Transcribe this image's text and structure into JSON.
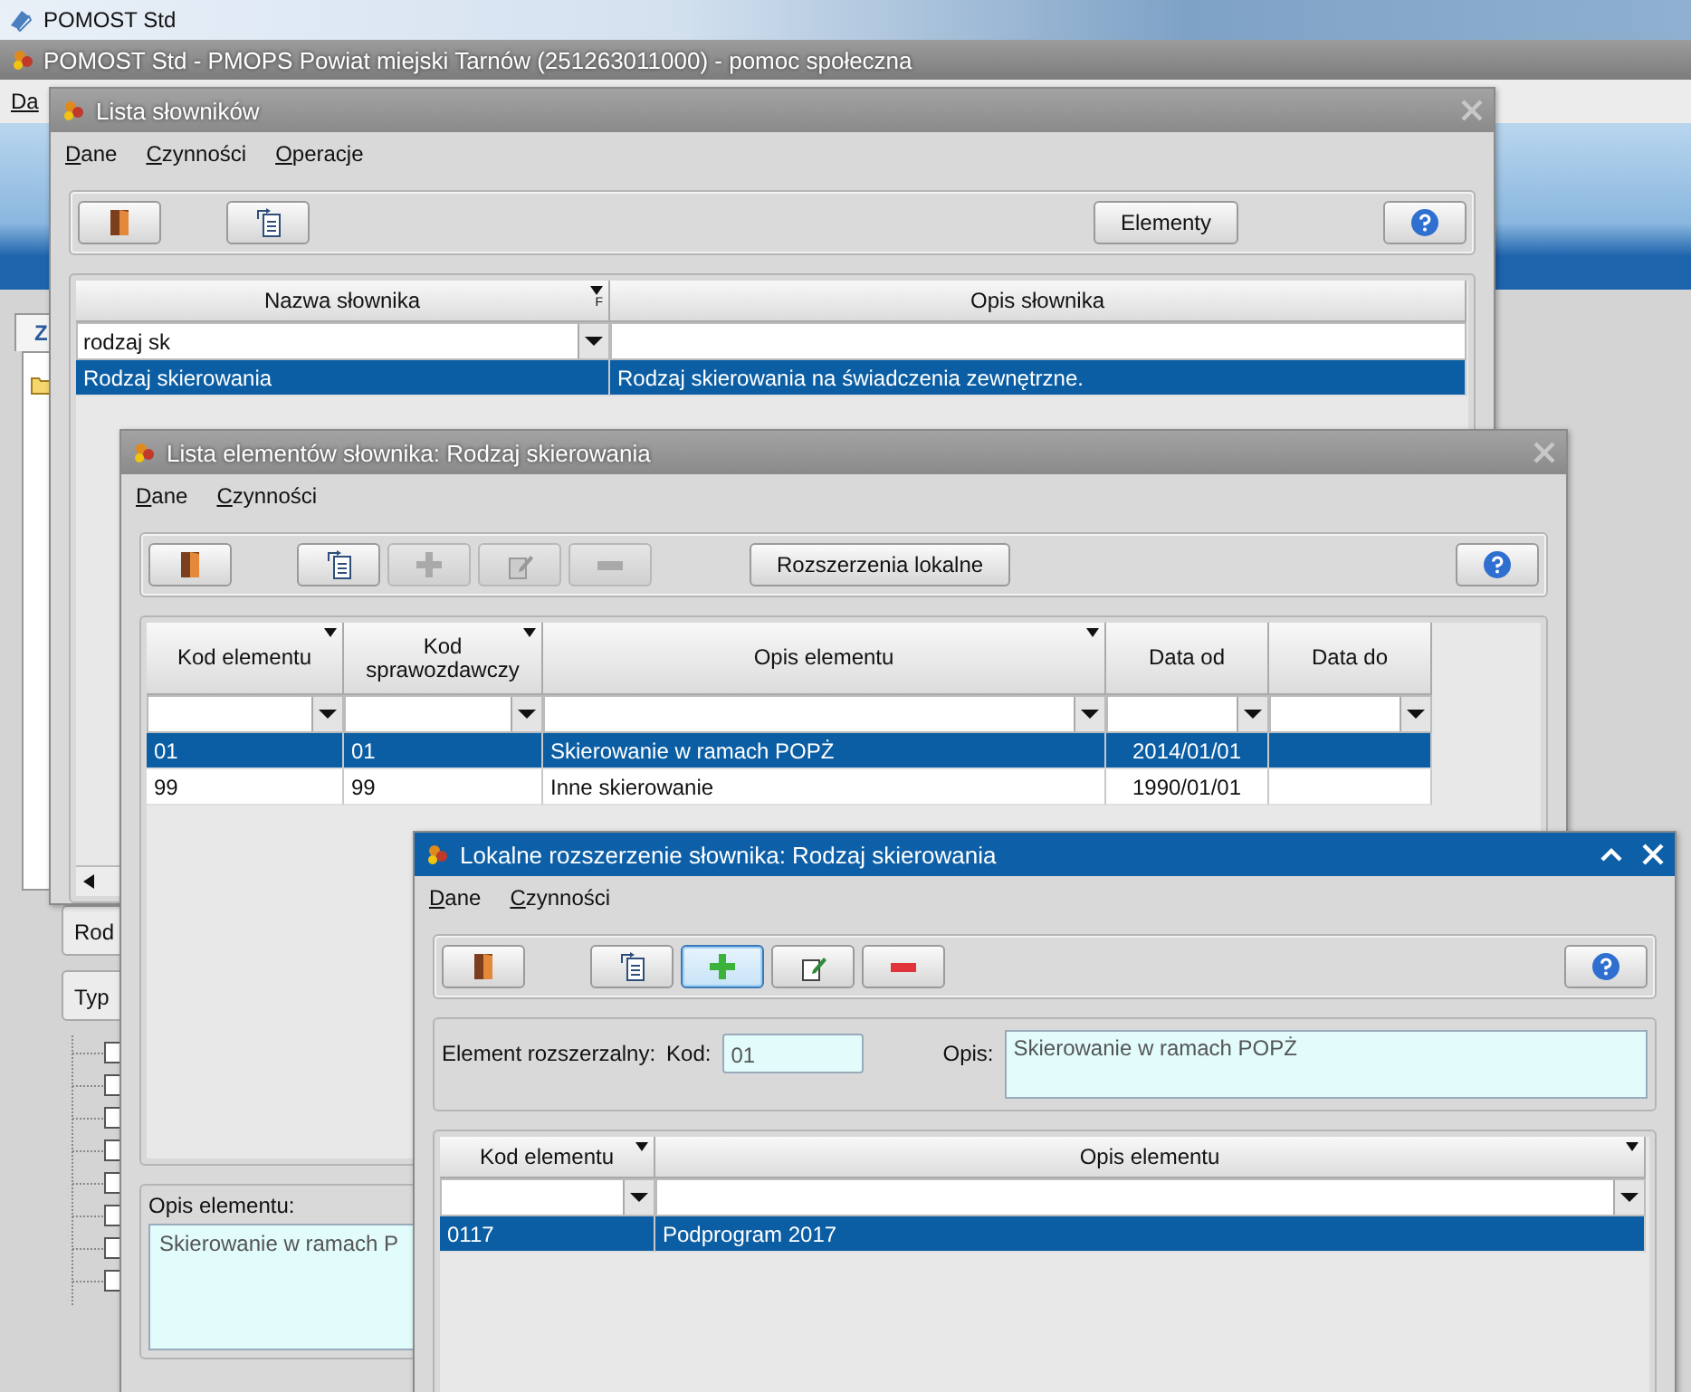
{
  "os_bar": {
    "title": "POMOST Std"
  },
  "app": {
    "title": "POMOST Std - PMOPS Powiat miejski Tarnów (251263011000) - pomoc społeczna",
    "menu": [
      "Da"
    ],
    "tab": "Z",
    "fields": [
      "Rod",
      "Typ"
    ]
  },
  "windows": [
    {
      "title": "Lista słowników",
      "active": false,
      "menu": [
        "Dane",
        "Czynności",
        "Operacje"
      ],
      "toolbar": [
        {
          "kind": "exit",
          "disabled": false,
          "focused": false
        },
        {
          "kind": "copy",
          "disabled": false,
          "focused": false
        },
        {
          "kind": "label",
          "label": "Elementy",
          "disabled": false,
          "focused": false
        },
        {
          "kind": "help",
          "disabled": false,
          "focused": false
        }
      ],
      "grid": {
        "columns": [
          {
            "label": "Nazwa słownika",
            "sort_marker": true,
            "flag": "F",
            "filter": "rodzaj sk",
            "dropdown": true
          },
          {
            "label": "Opis słownika",
            "sort_marker": false,
            "dropdown": false
          }
        ],
        "rows": [
          {
            "cells": [
              "Rodzaj skierowania",
              "Rodzaj skierowania na świadczenia zewnętrzne."
            ],
            "selected": true
          }
        ]
      }
    },
    {
      "title": "Lista elementów słownika: Rodzaj skierowania",
      "active": false,
      "menu": [
        "Dane",
        "Czynności"
      ],
      "toolbar": [
        {
          "kind": "exit",
          "disabled": false,
          "focused": false
        },
        {
          "kind": "copy",
          "disabled": false,
          "focused": false
        },
        {
          "kind": "add",
          "disabled": true,
          "focused": false
        },
        {
          "kind": "edit",
          "disabled": true,
          "focused": false
        },
        {
          "kind": "remove",
          "disabled": true,
          "focused": false
        },
        {
          "kind": "label",
          "label": "Rozszerzenia lokalne",
          "disabled": false,
          "focused": false
        },
        {
          "kind": "help",
          "disabled": false,
          "focused": false
        }
      ],
      "grid": {
        "columns": [
          {
            "label": "Kod elementu",
            "sort_marker": true,
            "dropdown": true
          },
          {
            "label": "Kod sprawozdawczy",
            "sort_marker": true,
            "dropdown": true
          },
          {
            "label": "Opis elementu",
            "sort_marker": true,
            "dropdown": true
          },
          {
            "label": "Data od",
            "sort_marker": false,
            "dropdown": true
          },
          {
            "label": "Data do",
            "sort_marker": false,
            "dropdown": true
          }
        ],
        "rows": [
          {
            "cells": [
              "01",
              "01",
              "Skierowanie w ramach POPŻ",
              "2014/01/01",
              ""
            ],
            "selected": true
          },
          {
            "cells": [
              "99",
              "99",
              "Inne skierowanie",
              "1990/01/01",
              ""
            ],
            "selected": false
          }
        ]
      },
      "description": {
        "label": "Opis elementu:",
        "value": "Skierowanie w ramach P"
      }
    },
    {
      "title": "Lokalne rozszerzenie słownika: Rodzaj skierowania",
      "active": true,
      "menu": [
        "Dane",
        "Czynności"
      ],
      "toolbar": [
        {
          "kind": "exit",
          "disabled": false,
          "focused": false
        },
        {
          "kind": "copy",
          "disabled": false,
          "focused": false
        },
        {
          "kind": "add",
          "disabled": false,
          "focused": true
        },
        {
          "kind": "edit",
          "disabled": false,
          "focused": false
        },
        {
          "kind": "remove",
          "disabled": false,
          "focused": false
        },
        {
          "kind": "help",
          "disabled": false,
          "focused": false
        }
      ],
      "form": {
        "label": "Element rozszerzalny:",
        "code_label": "Kod:",
        "code": "01",
        "desc_label": "Opis:",
        "desc": "Skierowanie w ramach POPŻ"
      },
      "grid": {
        "columns": [
          {
            "label": "Kod elementu",
            "sort_marker": true,
            "dropdown": true
          },
          {
            "label": "Opis elementu",
            "sort_marker": true,
            "dropdown": true
          }
        ],
        "rows": [
          {
            "cells": [
              "0117",
              "Podprogram 2017"
            ],
            "selected": true
          }
        ]
      }
    }
  ]
}
